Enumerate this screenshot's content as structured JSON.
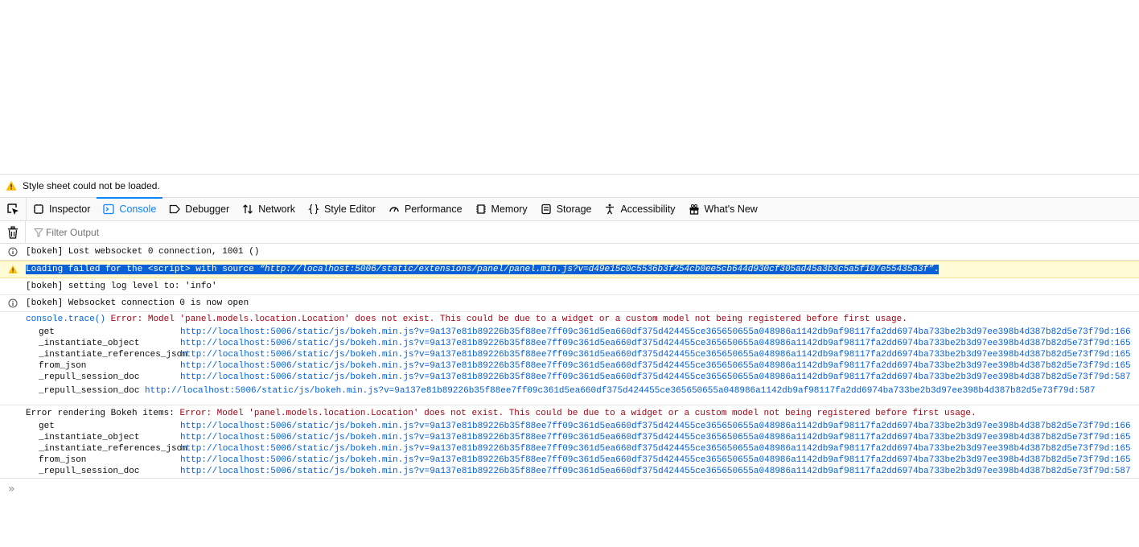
{
  "notice": {
    "text": "Style sheet could not be loaded."
  },
  "tabs": [
    {
      "label": "Inspector",
      "icon": "inspector-icon"
    },
    {
      "label": "Console",
      "icon": "console-icon",
      "selected": true
    },
    {
      "label": "Debugger",
      "icon": "debugger-icon"
    },
    {
      "label": "Network",
      "icon": "network-icon"
    },
    {
      "label": "Style Editor",
      "icon": "style-editor-icon"
    },
    {
      "label": "Performance",
      "icon": "performance-icon"
    },
    {
      "label": "Memory",
      "icon": "memory-icon"
    },
    {
      "label": "Storage",
      "icon": "storage-icon"
    },
    {
      "label": "Accessibility",
      "icon": "accessibility-icon"
    },
    {
      "label": "What's New",
      "icon": "whats-new-icon"
    }
  ],
  "filter": {
    "placeholder": "Filter Output"
  },
  "messages": {
    "m1": "[bokeh] Lost websocket 0 connection, 1001 ()",
    "m2_prefix": "Loading failed for the <script> with source ",
    "m2_url": "“http://localhost:5006/static/extensions/panel/panel.min.js?v=d49e15c0c5536b3f254cb0ee5cb644d930cf305ad45a3b3c5a5f107e55435a3f”",
    "m2_suffix": ".",
    "m3": "[bokeh] setting log level to: 'info'",
    "m4": "[bokeh] Websocket connection 0 is now open",
    "trace_fn": "console.trace()",
    "trace_err": " Error: Model 'panel.models.location.Location' does not exist. This could be due to a widget or a custom model not being registered before first usage.",
    "render_prefix": "Error rendering Bokeh items: ",
    "render_err": "Error: Model 'panel.models.location.Location' does not exist. This could be due to a widget or a custom model not being registered before first usage.",
    "location_fn": "_repull_session_doc",
    "location_url": "http://localhost:5006/static/js/bokeh.min.js?v=9a137e81b89226b35f88ee7ff09c361d5ea660df375d424455ce365650655a048986a1142db9af98117fa2dd6974ba733be2b3d97ee398b4d387b82d5e73f79d",
    "location_line": ":587"
  },
  "trace1": [
    {
      "fn": "get",
      "url": "http://localhost:5006/static/js/bokeh.min.js?v=9a137e81b89226b35f88ee7ff09c361d5ea660df375d424455ce365650655a048986a1142db9af98117fa2dd6974ba733be2b3d97ee398b4d387b82d5e73f79d",
      "line": ":166"
    },
    {
      "fn": "_instantiate_object",
      "url": "http://localhost:5006/static/js/bokeh.min.js?v=9a137e81b89226b35f88ee7ff09c361d5ea660df375d424455ce365650655a048986a1142db9af98117fa2dd6974ba733be2b3d97ee398b4d387b82d5e73f79d",
      "line": ":165"
    },
    {
      "fn": "_instantiate_references_json",
      "url": "http://localhost:5006/static/js/bokeh.min.js?v=9a137e81b89226b35f88ee7ff09c361d5ea660df375d424455ce365650655a048986a1142db9af98117fa2dd6974ba733be2b3d97ee398b4d387b82d5e73f79d",
      "line": ":165"
    },
    {
      "fn": "from_json",
      "url": "http://localhost:5006/static/js/bokeh.min.js?v=9a137e81b89226b35f88ee7ff09c361d5ea660df375d424455ce365650655a048986a1142db9af98117fa2dd6974ba733be2b3d97ee398b4d387b82d5e73f79d",
      "line": ":165"
    },
    {
      "fn": "_repull_session_doc",
      "url": "http://localhost:5006/static/js/bokeh.min.js?v=9a137e81b89226b35f88ee7ff09c361d5ea660df375d424455ce365650655a048986a1142db9af98117fa2dd6974ba733be2b3d97ee398b4d387b82d5e73f79d",
      "line": ":587"
    }
  ],
  "trace2": [
    {
      "fn": "get",
      "url": "http://localhost:5006/static/js/bokeh.min.js?v=9a137e81b89226b35f88ee7ff09c361d5ea660df375d424455ce365650655a048986a1142db9af98117fa2dd6974ba733be2b3d97ee398b4d387b82d5e73f79d",
      "line": ":166"
    },
    {
      "fn": "_instantiate_object",
      "url": "http://localhost:5006/static/js/bokeh.min.js?v=9a137e81b89226b35f88ee7ff09c361d5ea660df375d424455ce365650655a048986a1142db9af98117fa2dd6974ba733be2b3d97ee398b4d387b82d5e73f79d",
      "line": ":165"
    },
    {
      "fn": "_instantiate_references_json",
      "url": "http://localhost:5006/static/js/bokeh.min.js?v=9a137e81b89226b35f88ee7ff09c361d5ea660df375d424455ce365650655a048986a1142db9af98117fa2dd6974ba733be2b3d97ee398b4d387b82d5e73f79d",
      "line": ":165"
    },
    {
      "fn": "from_json",
      "url": "http://localhost:5006/static/js/bokeh.min.js?v=9a137e81b89226b35f88ee7ff09c361d5ea660df375d424455ce365650655a048986a1142db9af98117fa2dd6974ba733be2b3d97ee398b4d387b82d5e73f79d",
      "line": ":165"
    },
    {
      "fn": "_repull_session_doc",
      "url": "http://localhost:5006/static/js/bokeh.min.js?v=9a137e81b89226b35f88ee7ff09c361d5ea660df375d424455ce365650655a048986a1142db9af98117fa2dd6974ba733be2b3d97ee398b4d387b82d5e73f79d",
      "line": ":587"
    }
  ],
  "colors": {
    "accent": "#0a84ff",
    "error": "#a4000f",
    "link": "#0060df",
    "warning_bg": "#fffbd6"
  }
}
